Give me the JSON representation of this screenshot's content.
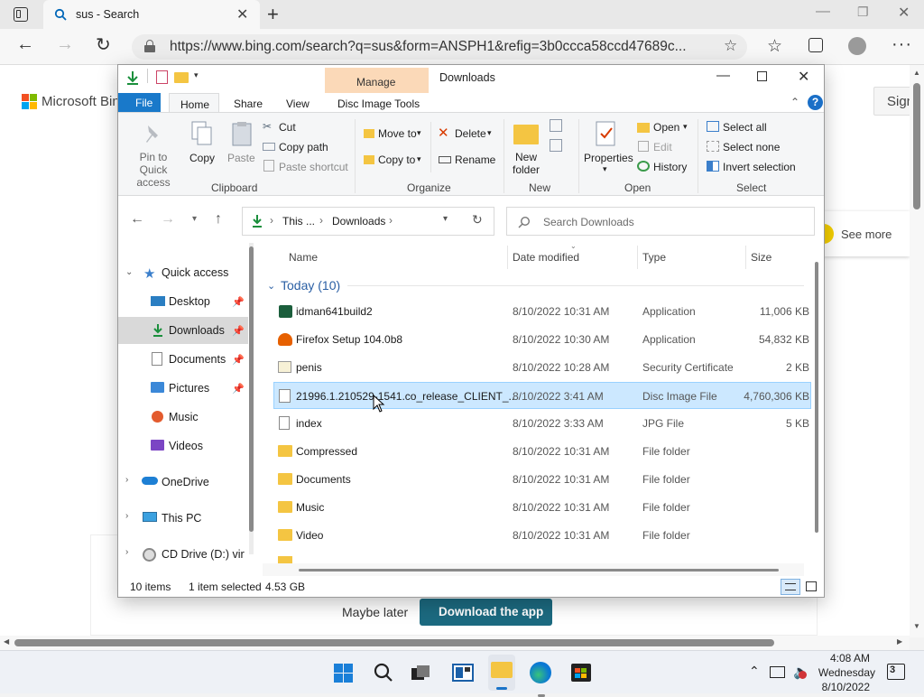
{
  "browser": {
    "tab_title": "sus - Search",
    "url": "https://www.bing.com/search?q=sus&form=ANSPH1&refig=3b0ccca58ccd47689c...",
    "page": {
      "logo_text": "Microsoft Bing",
      "sign_in": "Sign",
      "see_more": "See more",
      "maybe_later": "Maybe later",
      "download_app": "Download the app"
    }
  },
  "explorer": {
    "title": "Downloads",
    "manage_tab": "Manage",
    "tabs": [
      "File",
      "Home",
      "Share",
      "View",
      "Disc Image Tools"
    ],
    "ribbon": {
      "pin": "Pin to Quick access",
      "copy": "Copy",
      "paste": "Paste",
      "cut": "Cut",
      "copy_path": "Copy path",
      "paste_shortcut": "Paste shortcut",
      "clipboard": "Clipboard",
      "move_to": "Move to",
      "copy_to": "Copy to",
      "delete": "Delete",
      "rename": "Rename",
      "organize": "Organize",
      "new_folder": "New folder",
      "new": "New",
      "properties": "Properties",
      "open": "Open",
      "edit": "Edit",
      "history": "History",
      "open_group": "Open",
      "select_all": "Select all",
      "select_none": "Select none",
      "invert_selection": "Invert selection",
      "select_group": "Select"
    },
    "breadcrumb": [
      "This ...",
      "Downloads"
    ],
    "search_placeholder": "Search Downloads",
    "columns": [
      "Name",
      "Date modified",
      "Type",
      "Size"
    ],
    "group_label": "Today (10)",
    "nav": {
      "quick_access": "Quick access",
      "items": [
        "Desktop",
        "Downloads",
        "Documents",
        "Pictures",
        "Music",
        "Videos"
      ],
      "onedrive": "OneDrive",
      "this_pc": "This PC",
      "cd_drive": "CD Drive (D:) virti"
    },
    "files": [
      {
        "name": "idman641build2",
        "date": "8/10/2022 10:31 AM",
        "type": "Application",
        "size": "11,006 KB"
      },
      {
        "name": "Firefox Setup 104.0b8",
        "date": "8/10/2022 10:30 AM",
        "type": "Application",
        "size": "54,832 KB"
      },
      {
        "name": "penis",
        "date": "8/10/2022 10:28 AM",
        "type": "Security Certificate",
        "size": "2 KB"
      },
      {
        "name": "21996.1.210529-1541.co_release_CLIENT_...",
        "date": "8/10/2022 3:41 AM",
        "type": "Disc Image File",
        "size": "4,760,306 KB"
      },
      {
        "name": "index",
        "date": "8/10/2022 3:33 AM",
        "type": "JPG File",
        "size": "5 KB"
      },
      {
        "name": "Compressed",
        "date": "8/10/2022 10:31 AM",
        "type": "File folder",
        "size": ""
      },
      {
        "name": "Documents",
        "date": "8/10/2022 10:31 AM",
        "type": "File folder",
        "size": ""
      },
      {
        "name": "Music",
        "date": "8/10/2022 10:31 AM",
        "type": "File folder",
        "size": ""
      },
      {
        "name": "Video",
        "date": "8/10/2022 10:31 AM",
        "type": "File folder",
        "size": ""
      }
    ],
    "status": {
      "count": "10 items",
      "selected": "1 item selected",
      "size": "4.53 GB"
    }
  },
  "taskbar": {
    "time": "4:08 AM",
    "day": "Wednesday",
    "date": "8/10/2022",
    "notifications": "3"
  }
}
